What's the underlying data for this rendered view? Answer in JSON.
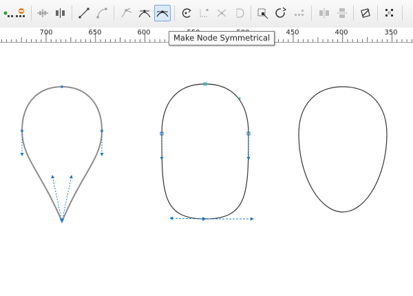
{
  "toolbar": {
    "buttons": [
      {
        "icon": "add-node-icon"
      },
      {
        "icon": "delete-node-icon"
      },
      {
        "icon": "join-nodes-icon"
      },
      {
        "icon": "break-curve-icon"
      },
      {
        "icon": "to-line-icon"
      },
      {
        "icon": "to-curve-icon"
      },
      {
        "icon": "make-node-cusp-icon"
      },
      {
        "icon": "make-node-smooth-icon"
      },
      {
        "icon": "make-node-symmetrical-icon",
        "active": true
      },
      {
        "icon": "reverse-direction-icon"
      },
      {
        "icon": "extend-curve-icon"
      },
      {
        "icon": "extract-subpath-icon"
      },
      {
        "icon": "auto-close-icon"
      },
      {
        "icon": "reflect-nodes-icon"
      },
      {
        "icon": "rotate-nodes-icon"
      },
      {
        "icon": "align-nodes-icon"
      },
      {
        "icon": "horizontal-mirror-icon"
      },
      {
        "icon": "vertical-mirror-icon"
      },
      {
        "icon": "elastic-mode-icon"
      },
      {
        "icon": "select-all-nodes-icon"
      }
    ]
  },
  "ruler": {
    "labels": [
      "700",
      "650",
      "600",
      "550",
      "500",
      "450",
      "400",
      "350"
    ]
  },
  "tooltip": {
    "text": "Make Node Symmetrical"
  },
  "colors": {
    "selection_blue": "#1a74c9",
    "node_cyan": "#1db3b3",
    "curve_dark": "#333333",
    "curve_gray": "#8c8c8c"
  }
}
